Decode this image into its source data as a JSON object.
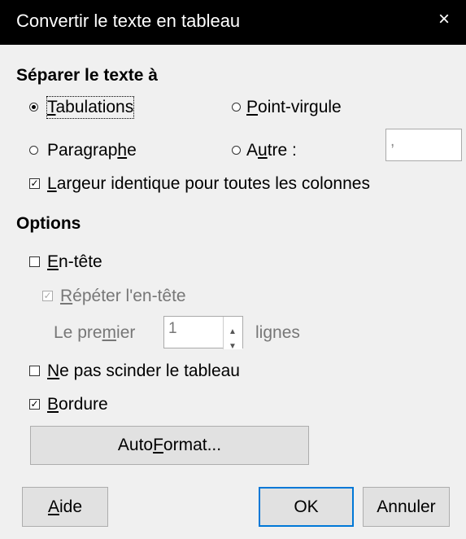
{
  "window": {
    "title": "Convertir le texte en tableau",
    "close_icon": "×"
  },
  "separate": {
    "heading": "Séparer le texte à",
    "tabs": {
      "label_u": "T",
      "label_rest": "abulations",
      "selected": true
    },
    "semicolon": {
      "label_u": "P",
      "label_rest": "oint-virgule",
      "selected": false
    },
    "paragraph": {
      "label_pre": "Paragrap",
      "label_u": "h",
      "label_rest": "e",
      "selected": false
    },
    "other": {
      "label_pre": "A",
      "label_u": "u",
      "label_rest": "tre :",
      "selected": false,
      "value": ","
    },
    "equal_width": {
      "label_u": "L",
      "label_rest": "argeur identique pour toutes les colonnes",
      "checked": true
    }
  },
  "options": {
    "heading": "Options",
    "header": {
      "label_u": "E",
      "label_rest": "n-tête",
      "checked": false
    },
    "repeat_header": {
      "label_u": "R",
      "label_rest": "épéter l'en-tête",
      "checked": true,
      "disabled": true
    },
    "first_rows": {
      "pre": "Le pre",
      "u": "m",
      "post": "ier",
      "value": "1",
      "suffix": "lignes",
      "disabled": true
    },
    "dont_split": {
      "label_u": "N",
      "label_rest": "e pas scinder le tableau",
      "checked": false
    },
    "border": {
      "label_u": "B",
      "label_rest": "ordure",
      "checked": true
    },
    "autoformat": {
      "pre": "Auto",
      "u": "F",
      "post": "ormat..."
    }
  },
  "buttons": {
    "help": {
      "u": "A",
      "rest": "ide"
    },
    "ok": "OK",
    "cancel": "Annuler"
  },
  "colors": {
    "title_bg": "#000000",
    "dialog_bg": "#f0f0f0",
    "accent": "#0078d7"
  }
}
